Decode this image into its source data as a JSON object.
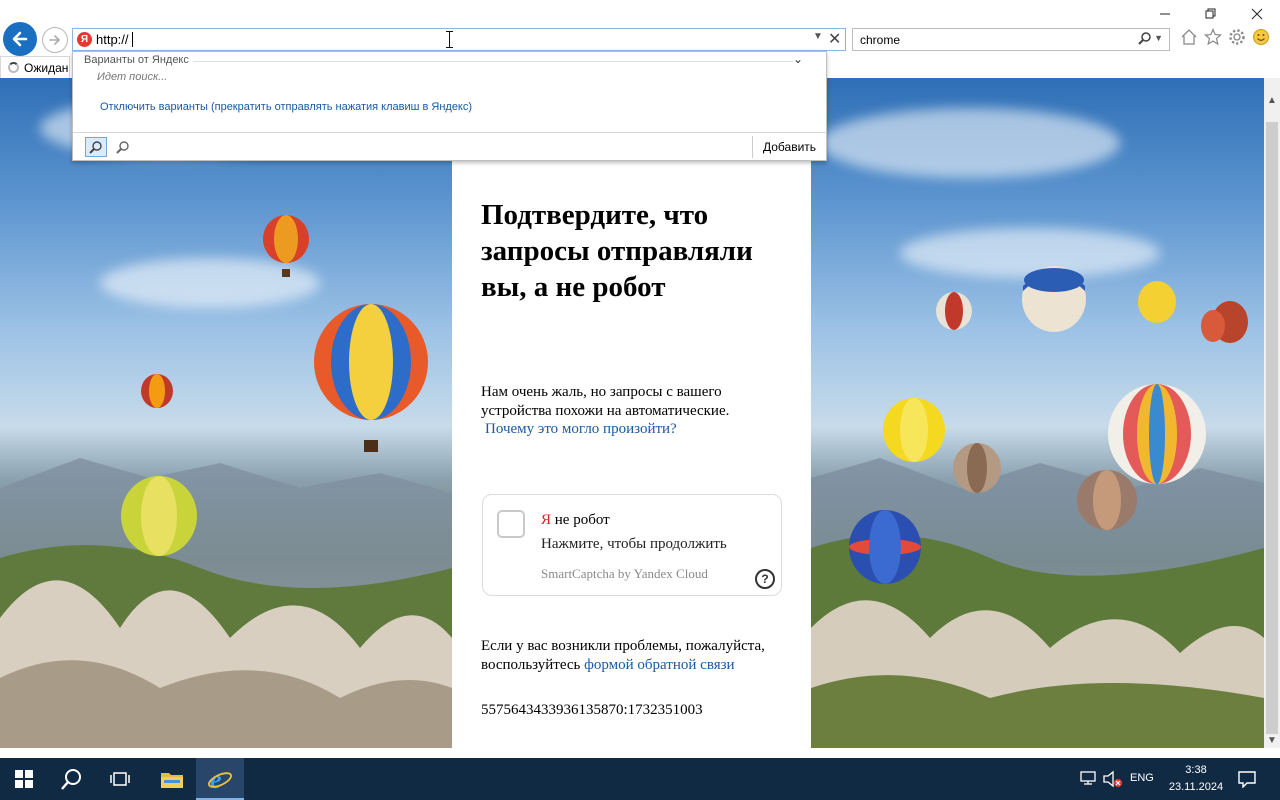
{
  "browser": {
    "address_value": "http://",
    "address_badge": "Я",
    "search_value": "chrome",
    "tab_label": "Ожидан",
    "tool_icons": [
      "home-icon",
      "star-icon",
      "gear-icon",
      "smiley-icon"
    ]
  },
  "suggest": {
    "header": "Варианты от Яндекс",
    "searching": "Идет поиск...",
    "disable_link": "Отключить варианты (прекратить отправлять нажатия клавиш в Яндекс)",
    "add_label": "Добавить"
  },
  "captcha_page": {
    "title": "Подтвердите, что запросы отправляли вы, а не робот",
    "message": "Нам очень жаль, но запросы с вашего устройства похожи на автоматические.",
    "why_link": "Почему это могло произойти?",
    "widget": {
      "ya": "Я",
      "label_rest": " не робот",
      "subtitle": "Нажмите, чтобы продолжить",
      "brand": "SmartCaptcha by Yandex Cloud",
      "help": "?"
    },
    "footer_text": "Если у вас возникли проблемы, пожалуйста, воспользуйтесь",
    "footer_link": "формой обратной связи",
    "request_id": "5575643433936135870:1732351003"
  },
  "taskbar": {
    "lang": "ENG",
    "time": "3:38",
    "date": "23.11.2024"
  },
  "colors": {
    "accent": "#1a6fc0",
    "link": "#1a5aa0",
    "taskbar": "#112a44",
    "yandex_red": "#e53935"
  }
}
